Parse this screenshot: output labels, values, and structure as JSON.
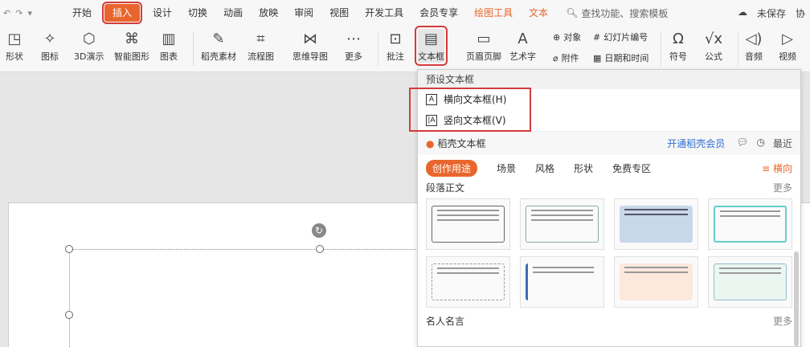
{
  "menu": {
    "quick_access": [
      "↶",
      "↷",
      "▾"
    ],
    "items": [
      "开始",
      "插入",
      "设计",
      "切换",
      "动画",
      "放映",
      "审阅",
      "视图",
      "开发工具",
      "会员专享",
      "绘图工具",
      "文本"
    ],
    "search_label": "查找功能、搜索模板",
    "unsaved": "未保存",
    "collab": "协"
  },
  "ribbon": {
    "buttons": [
      "形状",
      "图标",
      "3D演示",
      "智能图形",
      "图表",
      "稻壳素材",
      "流程图",
      "思维导图",
      "更多",
      "批注",
      "文本框",
      "页眉页脚",
      "艺术字",
      "符号",
      "公式",
      "音频",
      "视频"
    ],
    "small": {
      "object": "对象",
      "slide_number": "幻灯片编号",
      "attachment": "附件",
      "datetime": "日期和时间"
    }
  },
  "dropdown": {
    "preset_header": "预设文本框",
    "horizontal": "横向文本框(H)",
    "vertical": "竖向文本框(V)",
    "dk_title": "稻壳文本框",
    "member_link": "开通稻壳会员",
    "recent": "最近",
    "tabs": [
      "创作用途",
      "场景",
      "风格",
      "形状",
      "免费专区"
    ],
    "direction": "横向",
    "section1": "段落正文",
    "section2": "名人名言",
    "more": "更多"
  },
  "colors": {
    "accent": "#e8662d",
    "highlight": "#d43b3b",
    "link": "#2f6ed6"
  }
}
